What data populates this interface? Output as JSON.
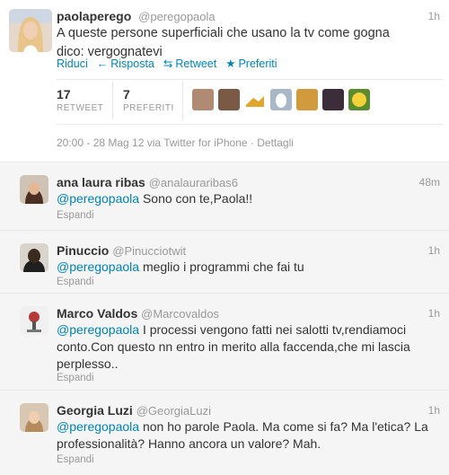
{
  "main_tweet": {
    "name": "paolaperego",
    "handle": "@peregopaola",
    "time": "1h",
    "text": "A queste persone superficiali che usano la tv come gogna dico: vergognatevi",
    "actions": {
      "reply": "Riduci",
      "reply_label": "Risposta",
      "retweet": "Retweet",
      "favorite": "Preferiti"
    },
    "stats": {
      "retweet_count": "17",
      "retweet_label": "RETWEET",
      "favorites_count": "7",
      "favorites_label": "PREFERITI"
    },
    "meta": "20:00 - 28 Mag 12 via Twitter for iPhone · Dettagli"
  },
  "replies": [
    {
      "name": "ana laura ribas",
      "handle": "@analauraribas6",
      "time": "48m",
      "mention": "@peregopaola",
      "text": " Sono con te,Paola!!",
      "expand": "Espandi"
    },
    {
      "name": "Pinuccio",
      "handle": "@Pinucciotwit",
      "time": "1h",
      "mention": "@peregopaola",
      "text": " meglio i programmi che fai tu",
      "expand": "Espandi"
    },
    {
      "name": "Marco Valdos",
      "handle": "@Marcovaldos",
      "time": "1h",
      "mention": "@peregopaola",
      "text": " I processi vengono fatti nei salotti tv,rendiamoci conto.Con questo nn entro in merito alla faccenda,che mi lascia perplesso..",
      "expand": "Espandi"
    },
    {
      "name": "Georgia Luzi",
      "handle": "@GeorgiaLuzi",
      "time": "1h",
      "mention": "@peregopaola",
      "text": " non ho parole Paola. Ma come si fa? Ma l'etica? La professionalità? Hanno ancora un valore? Mah.",
      "expand": "Espandi"
    }
  ],
  "colors": {
    "link": "#0084b4",
    "muted": "#999999",
    "reply_bg": "#f5f5f5"
  }
}
